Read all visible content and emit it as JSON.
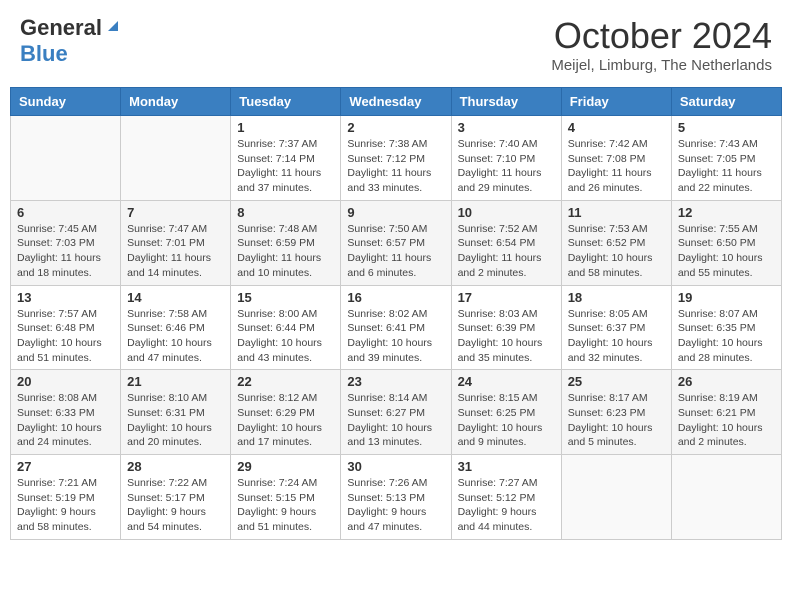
{
  "header": {
    "logo_general": "General",
    "logo_blue": "Blue",
    "month_title": "October 2024",
    "location": "Meijel, Limburg, The Netherlands"
  },
  "days_of_week": [
    "Sunday",
    "Monday",
    "Tuesday",
    "Wednesday",
    "Thursday",
    "Friday",
    "Saturday"
  ],
  "weeks": [
    [
      {
        "day": "",
        "sunrise": "",
        "sunset": "",
        "daylight": ""
      },
      {
        "day": "",
        "sunrise": "",
        "sunset": "",
        "daylight": ""
      },
      {
        "day": "1",
        "sunrise": "Sunrise: 7:37 AM",
        "sunset": "Sunset: 7:14 PM",
        "daylight": "Daylight: 11 hours and 37 minutes."
      },
      {
        "day": "2",
        "sunrise": "Sunrise: 7:38 AM",
        "sunset": "Sunset: 7:12 PM",
        "daylight": "Daylight: 11 hours and 33 minutes."
      },
      {
        "day": "3",
        "sunrise": "Sunrise: 7:40 AM",
        "sunset": "Sunset: 7:10 PM",
        "daylight": "Daylight: 11 hours and 29 minutes."
      },
      {
        "day": "4",
        "sunrise": "Sunrise: 7:42 AM",
        "sunset": "Sunset: 7:08 PM",
        "daylight": "Daylight: 11 hours and 26 minutes."
      },
      {
        "day": "5",
        "sunrise": "Sunrise: 7:43 AM",
        "sunset": "Sunset: 7:05 PM",
        "daylight": "Daylight: 11 hours and 22 minutes."
      }
    ],
    [
      {
        "day": "6",
        "sunrise": "Sunrise: 7:45 AM",
        "sunset": "Sunset: 7:03 PM",
        "daylight": "Daylight: 11 hours and 18 minutes."
      },
      {
        "day": "7",
        "sunrise": "Sunrise: 7:47 AM",
        "sunset": "Sunset: 7:01 PM",
        "daylight": "Daylight: 11 hours and 14 minutes."
      },
      {
        "day": "8",
        "sunrise": "Sunrise: 7:48 AM",
        "sunset": "Sunset: 6:59 PM",
        "daylight": "Daylight: 11 hours and 10 minutes."
      },
      {
        "day": "9",
        "sunrise": "Sunrise: 7:50 AM",
        "sunset": "Sunset: 6:57 PM",
        "daylight": "Daylight: 11 hours and 6 minutes."
      },
      {
        "day": "10",
        "sunrise": "Sunrise: 7:52 AM",
        "sunset": "Sunset: 6:54 PM",
        "daylight": "Daylight: 11 hours and 2 minutes."
      },
      {
        "day": "11",
        "sunrise": "Sunrise: 7:53 AM",
        "sunset": "Sunset: 6:52 PM",
        "daylight": "Daylight: 10 hours and 58 minutes."
      },
      {
        "day": "12",
        "sunrise": "Sunrise: 7:55 AM",
        "sunset": "Sunset: 6:50 PM",
        "daylight": "Daylight: 10 hours and 55 minutes."
      }
    ],
    [
      {
        "day": "13",
        "sunrise": "Sunrise: 7:57 AM",
        "sunset": "Sunset: 6:48 PM",
        "daylight": "Daylight: 10 hours and 51 minutes."
      },
      {
        "day": "14",
        "sunrise": "Sunrise: 7:58 AM",
        "sunset": "Sunset: 6:46 PM",
        "daylight": "Daylight: 10 hours and 47 minutes."
      },
      {
        "day": "15",
        "sunrise": "Sunrise: 8:00 AM",
        "sunset": "Sunset: 6:44 PM",
        "daylight": "Daylight: 10 hours and 43 minutes."
      },
      {
        "day": "16",
        "sunrise": "Sunrise: 8:02 AM",
        "sunset": "Sunset: 6:41 PM",
        "daylight": "Daylight: 10 hours and 39 minutes."
      },
      {
        "day": "17",
        "sunrise": "Sunrise: 8:03 AM",
        "sunset": "Sunset: 6:39 PM",
        "daylight": "Daylight: 10 hours and 35 minutes."
      },
      {
        "day": "18",
        "sunrise": "Sunrise: 8:05 AM",
        "sunset": "Sunset: 6:37 PM",
        "daylight": "Daylight: 10 hours and 32 minutes."
      },
      {
        "day": "19",
        "sunrise": "Sunrise: 8:07 AM",
        "sunset": "Sunset: 6:35 PM",
        "daylight": "Daylight: 10 hours and 28 minutes."
      }
    ],
    [
      {
        "day": "20",
        "sunrise": "Sunrise: 8:08 AM",
        "sunset": "Sunset: 6:33 PM",
        "daylight": "Daylight: 10 hours and 24 minutes."
      },
      {
        "day": "21",
        "sunrise": "Sunrise: 8:10 AM",
        "sunset": "Sunset: 6:31 PM",
        "daylight": "Daylight: 10 hours and 20 minutes."
      },
      {
        "day": "22",
        "sunrise": "Sunrise: 8:12 AM",
        "sunset": "Sunset: 6:29 PM",
        "daylight": "Daylight: 10 hours and 17 minutes."
      },
      {
        "day": "23",
        "sunrise": "Sunrise: 8:14 AM",
        "sunset": "Sunset: 6:27 PM",
        "daylight": "Daylight: 10 hours and 13 minutes."
      },
      {
        "day": "24",
        "sunrise": "Sunrise: 8:15 AM",
        "sunset": "Sunset: 6:25 PM",
        "daylight": "Daylight: 10 hours and 9 minutes."
      },
      {
        "day": "25",
        "sunrise": "Sunrise: 8:17 AM",
        "sunset": "Sunset: 6:23 PM",
        "daylight": "Daylight: 10 hours and 5 minutes."
      },
      {
        "day": "26",
        "sunrise": "Sunrise: 8:19 AM",
        "sunset": "Sunset: 6:21 PM",
        "daylight": "Daylight: 10 hours and 2 minutes."
      }
    ],
    [
      {
        "day": "27",
        "sunrise": "Sunrise: 7:21 AM",
        "sunset": "Sunset: 5:19 PM",
        "daylight": "Daylight: 9 hours and 58 minutes."
      },
      {
        "day": "28",
        "sunrise": "Sunrise: 7:22 AM",
        "sunset": "Sunset: 5:17 PM",
        "daylight": "Daylight: 9 hours and 54 minutes."
      },
      {
        "day": "29",
        "sunrise": "Sunrise: 7:24 AM",
        "sunset": "Sunset: 5:15 PM",
        "daylight": "Daylight: 9 hours and 51 minutes."
      },
      {
        "day": "30",
        "sunrise": "Sunrise: 7:26 AM",
        "sunset": "Sunset: 5:13 PM",
        "daylight": "Daylight: 9 hours and 47 minutes."
      },
      {
        "day": "31",
        "sunrise": "Sunrise: 7:27 AM",
        "sunset": "Sunset: 5:12 PM",
        "daylight": "Daylight: 9 hours and 44 minutes."
      },
      {
        "day": "",
        "sunrise": "",
        "sunset": "",
        "daylight": ""
      },
      {
        "day": "",
        "sunrise": "",
        "sunset": "",
        "daylight": ""
      }
    ]
  ]
}
